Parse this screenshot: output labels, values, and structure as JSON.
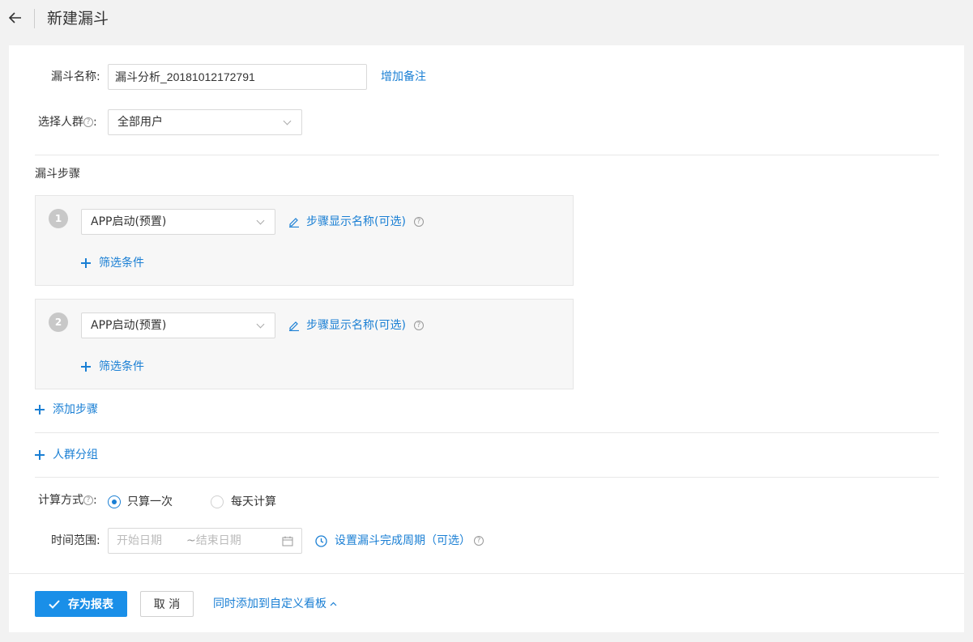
{
  "header": {
    "title": "新建漏斗"
  },
  "form": {
    "name_label": "漏斗名称:",
    "name_value": "漏斗分析_20181012172791",
    "add_note": "增加备注",
    "crowd_label": "选择人群",
    "crowd_colon": ":",
    "crowd_value": "全部用户",
    "steps_title": "漏斗步骤",
    "steps": [
      {
        "num": "1",
        "event": "APP启动(预置)",
        "display_name_link": "步骤显示名称(可选)",
        "filter_link": "筛选条件"
      },
      {
        "num": "2",
        "event": "APP启动(预置)",
        "display_name_link": "步骤显示名称(可选)",
        "filter_link": "筛选条件"
      }
    ],
    "add_step": "添加步骤",
    "crowd_group": "人群分组",
    "calc_label": "计算方式",
    "calc_colon": ":",
    "calc_options": [
      {
        "label": "只算一次",
        "selected": true
      },
      {
        "label": "每天计算",
        "selected": false
      }
    ],
    "time_label": "时间范围:",
    "time_start_placeholder": "开始日期",
    "time_sep": "~",
    "time_end_placeholder": "结束日期",
    "period_link": "设置漏斗完成周期（可选）"
  },
  "footer": {
    "save": "存为报表",
    "cancel": "取 消",
    "add_to_board": "同时添加到自定义看板"
  },
  "colors": {
    "accent": "#1a7fd4",
    "primary_button": "#1a8fe8"
  }
}
